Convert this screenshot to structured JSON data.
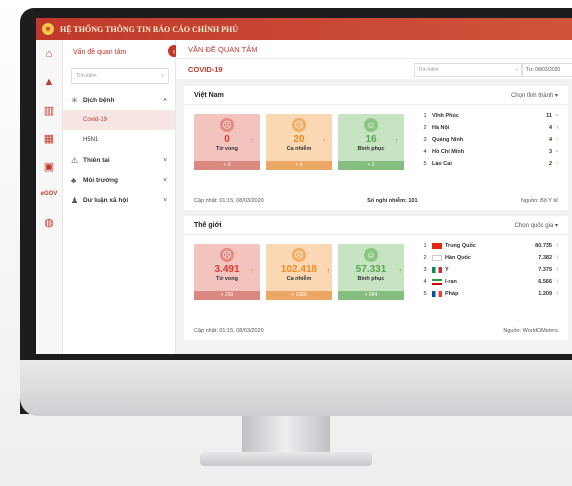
{
  "app": {
    "title": "HỆ THỐNG THÔNG TIN BÁO CÁO CHÍNH PHỦ"
  },
  "colors": {
    "brand": "#c0392b",
    "deaths": "#d63b2e",
    "cases": "#f08a23",
    "recovered": "#58a650"
  },
  "rail": {
    "icons": [
      "home-icon",
      "warning-icon",
      "chart-icon",
      "calendar-icon",
      "building-icon",
      "egov-icon",
      "globe-icon"
    ],
    "egov_label": "eGOV"
  },
  "sidebar": {
    "title": "Vấn đề quan tâm",
    "search_placeholder": "Tìm kiếm",
    "items": [
      {
        "label": "Dịch bệnh",
        "subs": [
          "Covid-19",
          "H5N1"
        ]
      },
      {
        "label": "Thiên tai"
      },
      {
        "label": "Môi trường"
      },
      {
        "label": "Dư luận xã hội"
      }
    ]
  },
  "main": {
    "section_title": "VẤN ĐỀ QUAN TÂM",
    "topic": "COVID-19",
    "search_placeholder": "Tìm kiếm",
    "date": "Tư: 08/03/2020"
  },
  "vietnam": {
    "title": "Việt Nam",
    "selector": "Chọn tỉnh thành",
    "cards": [
      {
        "value": "0",
        "label": "Tử vong",
        "delta": "+ 0"
      },
      {
        "value": "20",
        "label": "Ca nhiễm",
        "delta": "+ 4"
      },
      {
        "value": "16",
        "label": "Bình phục",
        "delta": "+ 2"
      }
    ],
    "ranking": [
      {
        "rank": "1",
        "name": "Vĩnh Phúc",
        "value": "11"
      },
      {
        "rank": "2",
        "name": "Hà Nội",
        "value": "4"
      },
      {
        "rank": "3",
        "name": "Quảng Ninh",
        "value": "4"
      },
      {
        "rank": "4",
        "name": "Hồ Chí Minh",
        "value": "3"
      },
      {
        "rank": "5",
        "name": "Lào Cai",
        "value": "2"
      }
    ],
    "updated": "Cập nhật: 01:15, 08/03/2020",
    "suspected": "Số nghi nhiễm: 101",
    "source": "Nguồn: Bộ Y tế"
  },
  "world": {
    "title": "Thế giới",
    "selector": "Chọn quốc gia",
    "cards": [
      {
        "value": "3.491",
        "label": "Tử vong",
        "delta": "+ 250"
      },
      {
        "value": "102.418",
        "label": "Ca nhiễm",
        "delta": "+ 1360"
      },
      {
        "value": "57.331",
        "label": "Bình phục",
        "delta": "+ 684"
      }
    ],
    "ranking": [
      {
        "rank": "1",
        "name": "Trung Quốc",
        "value": "80.735"
      },
      {
        "rank": "2",
        "name": "Hàn Quốc",
        "value": "7.382"
      },
      {
        "rank": "3",
        "name": "Ý",
        "value": "7.375"
      },
      {
        "rank": "4",
        "name": "I-ran",
        "value": "6.566"
      },
      {
        "rank": "5",
        "name": "Pháp",
        "value": "1.209"
      }
    ],
    "updated": "Cập nhật: 01:15, 08/03/2020",
    "source": "Nguồn: WorldOMeters"
  }
}
